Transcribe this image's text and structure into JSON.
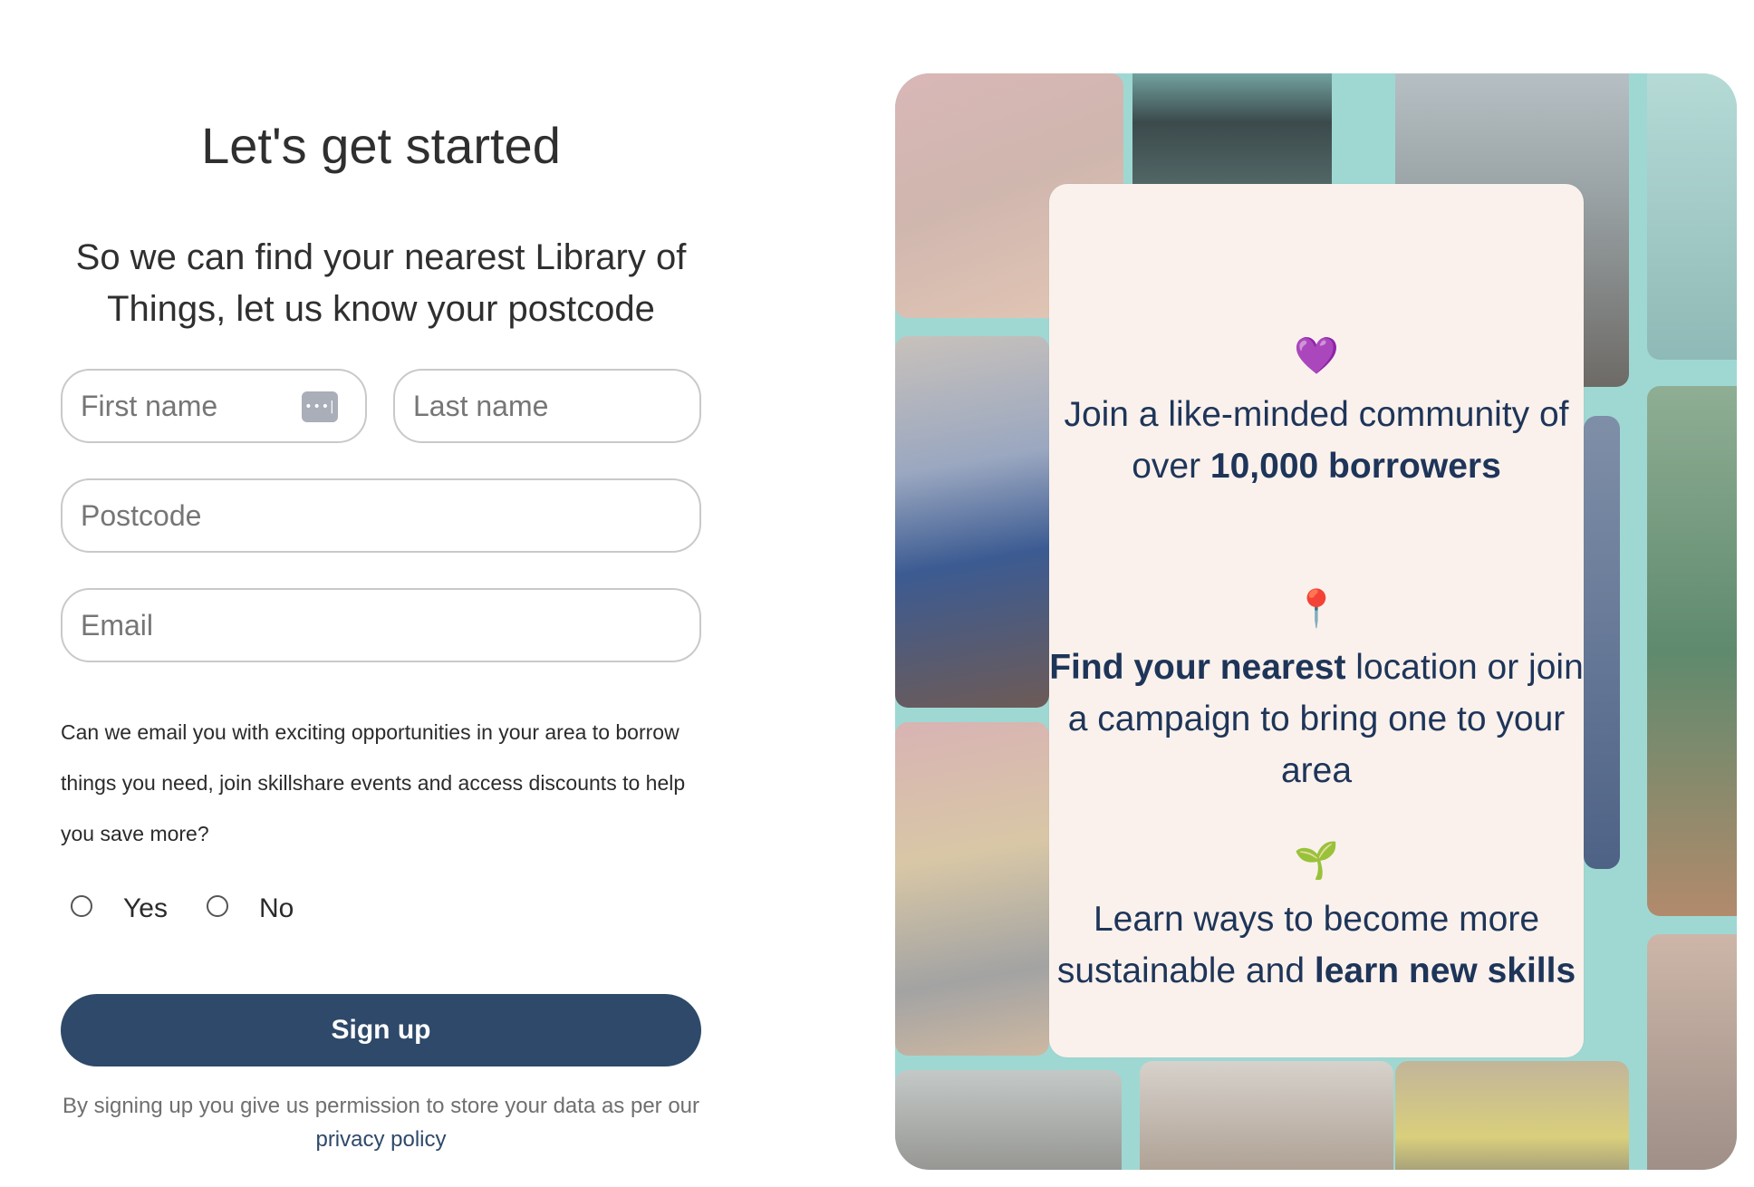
{
  "form": {
    "title": "Let's get started",
    "subtitle": "So we can find your nearest Library of Things, let us know your postcode",
    "first_name_placeholder": "First name",
    "last_name_placeholder": "Last name",
    "postcode_placeholder": "Postcode",
    "email_placeholder": "Email",
    "autofill_icon": "password-autofill-icon",
    "question": "Can we email you with exciting opportunities in your area to borrow things you need, join skillshare events and access discounts to help you save more?",
    "options": [
      {
        "label": "Yes"
      },
      {
        "label": "No"
      }
    ],
    "signup_label": "Sign up",
    "consent_text": "By signing up you give us permission to store your data as per our",
    "privacy_link": "privacy policy"
  },
  "promo": {
    "features": [
      {
        "icon": "purple-heart-icon",
        "emoji": "💜",
        "text_before": "Join a like-minded community of over ",
        "text_bold": "10,000 borrowers",
        "text_after": ""
      },
      {
        "icon": "pushpin-icon",
        "emoji": "📍",
        "text_before": "",
        "text_bold": "Find your nearest",
        "text_after": " location or join a campaign to bring one to your area"
      },
      {
        "icon": "seedling-icon",
        "emoji": "🌱",
        "text_before": "Learn ways to become more sustainable and ",
        "text_bold": "learn new skills",
        "text_after": ""
      }
    ],
    "colors": {
      "panel_background": "#9fd8d3",
      "card_background": "#faf1ec",
      "text": "#1e3559",
      "button": "#2e4969"
    }
  }
}
